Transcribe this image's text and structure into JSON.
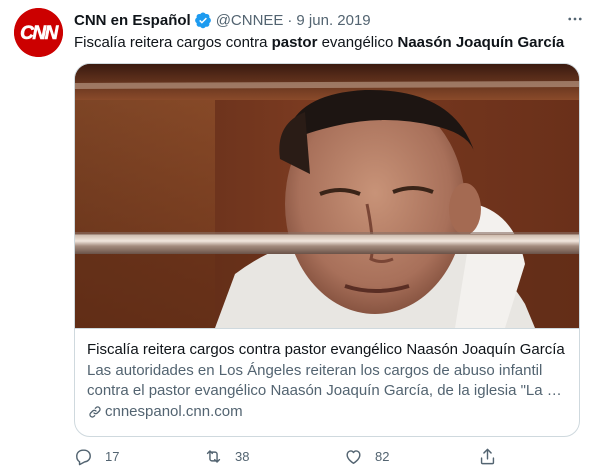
{
  "author": {
    "name": "CNN en Español",
    "handle": "@CNNEE",
    "separator": "·",
    "date": "9 jun. 2019",
    "avatar_logo": "CNN",
    "verified_icon": "verified-badge-icon"
  },
  "tweet": {
    "text_1": "Fiscalía reitera cargos contra ",
    "bold_1": "pastor",
    "text_2": " evangélico ",
    "bold_2": "Naasón Joaquín García"
  },
  "card": {
    "title": "Fiscalía reitera cargos contra pastor evangélico Naasón Joaquín García",
    "description_line_1": "Las autoridades en Los Ángeles reiteran los cargos de abuso infantil",
    "description_line_2": "contra el pastor evangélico Naasón Joaquín García, de la iglesia \"La Luz del Mundo\"",
    "domain": "cnnespanol.cnn.com"
  },
  "actions": {
    "reply_count": "17",
    "retweet_count": "38",
    "like_count": "82"
  },
  "colors": {
    "text": "#0f1419",
    "secondary": "#536471",
    "border": "#cfd9de",
    "verified": "#1d9bf0",
    "brand_red": "#cc0000"
  }
}
